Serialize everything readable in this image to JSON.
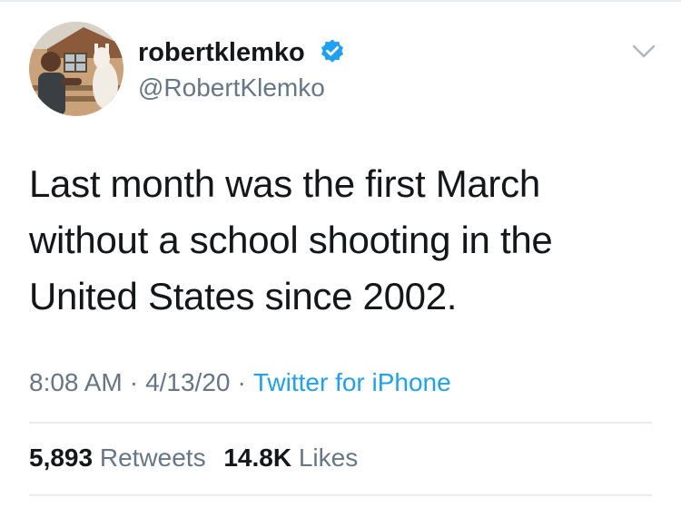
{
  "user": {
    "display_name": "robertklemko",
    "handle": "@RobertKlemko",
    "verified": true,
    "verified_color": "#1da1f2"
  },
  "tweet": {
    "text": "Last month was the first March without a school shooting in the United States since 2002.",
    "time": "8:08 AM",
    "date": "4/13/20",
    "source": "Twitter for iPhone",
    "separator": "·"
  },
  "stats": {
    "retweets_count": "5,893",
    "retweets_label": "Retweets",
    "likes_count": "14.8K",
    "likes_label": "Likes"
  },
  "icons": {
    "verified": "verified-badge-icon",
    "menu": "chevron-down-icon"
  },
  "colors": {
    "text_primary": "#14171a",
    "text_secondary": "#657786",
    "link": "#1da1f2",
    "divider": "#e6ecf0"
  }
}
